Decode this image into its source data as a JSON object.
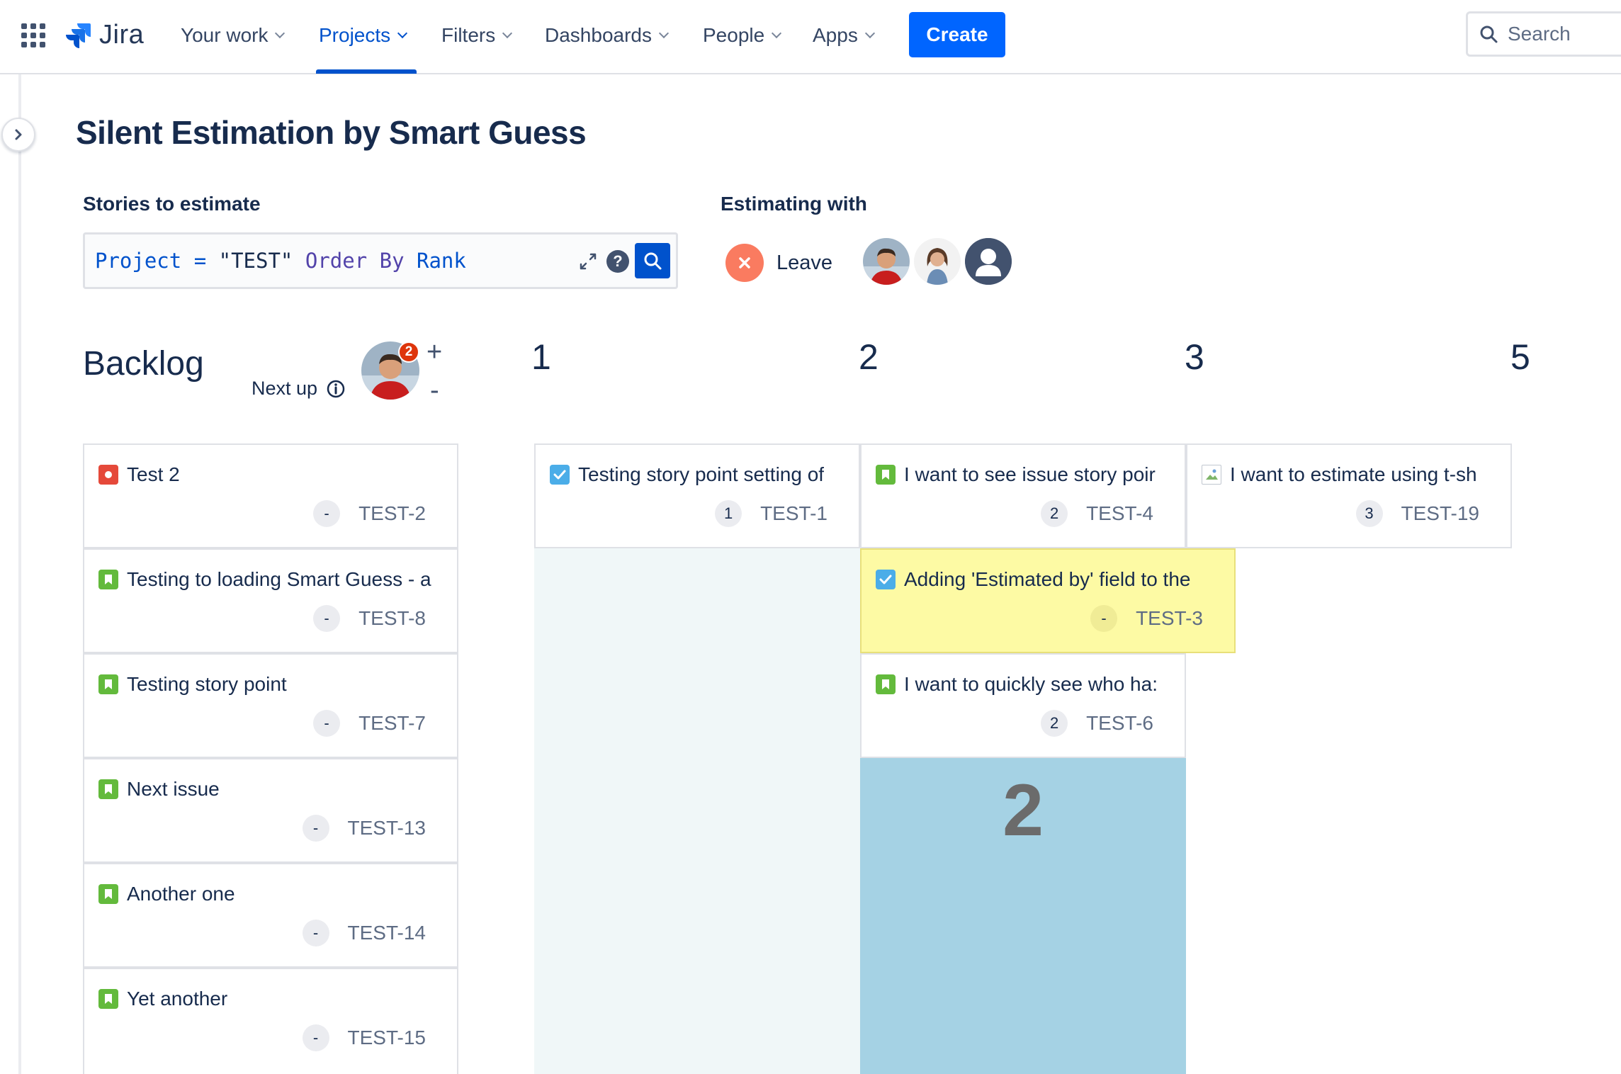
{
  "nav": {
    "logo_text": "Jira",
    "items": [
      "Your work",
      "Projects",
      "Filters",
      "Dashboards",
      "People",
      "Apps"
    ],
    "create_label": "Create",
    "search_placeholder": "Search"
  },
  "page": {
    "title": "Silent Estimation by Smart Guess",
    "stories_label": "Stories to estimate",
    "estimating_label": "Estimating with",
    "leave_label": "Leave",
    "jql": {
      "field": "Project",
      "op": "=",
      "value": "\"TEST\"",
      "order": "Order By",
      "rank": "Rank"
    }
  },
  "backlog": {
    "title": "Backlog",
    "next_up_label": "Next up",
    "next_up_badge": "2",
    "plus": "+",
    "minus": "-",
    "cards": [
      {
        "title": "Test 2",
        "type": "bug",
        "points": "-",
        "key": "TEST-2"
      },
      {
        "title": "Testing to loading Smart Guess - a",
        "type": "story",
        "points": "-",
        "key": "TEST-8"
      },
      {
        "title": "Testing story point",
        "type": "story",
        "points": "-",
        "key": "TEST-7"
      },
      {
        "title": "Next issue",
        "type": "story",
        "points": "-",
        "key": "TEST-13"
      },
      {
        "title": "Another one",
        "type": "story",
        "points": "-",
        "key": "TEST-14"
      },
      {
        "title": "Yet another",
        "type": "story",
        "points": "-",
        "key": "TEST-15"
      }
    ]
  },
  "columns": [
    {
      "label": "1"
    },
    {
      "label": "2",
      "count": "2"
    },
    {
      "label": "3"
    },
    {
      "label": "5"
    }
  ],
  "estimate_cards": {
    "col1": [
      {
        "title": "Testing story point setting of",
        "type": "task",
        "points": "1",
        "key": "TEST-1"
      }
    ],
    "col2": [
      {
        "title": "I want to see issue story poir",
        "type": "story",
        "points": "2",
        "key": "TEST-4"
      },
      {
        "title": "Adding 'Estimated by' field to the",
        "type": "task",
        "points": "-",
        "key": "TEST-3"
      },
      {
        "title": "I want to quickly see who ha:",
        "type": "story",
        "points": "2",
        "key": "TEST-6"
      }
    ],
    "col3": [
      {
        "title": "I want to estimate using t-sh",
        "type": "broken-image",
        "points": "3",
        "key": "TEST-19"
      }
    ]
  },
  "colors": {
    "accent": "#0052cc",
    "create": "#0065ff",
    "highlight_card": "#fdfaa4",
    "column_active": "#a5d2e4",
    "column_light": "#f0f7f8",
    "leave": "#fa7b60"
  }
}
